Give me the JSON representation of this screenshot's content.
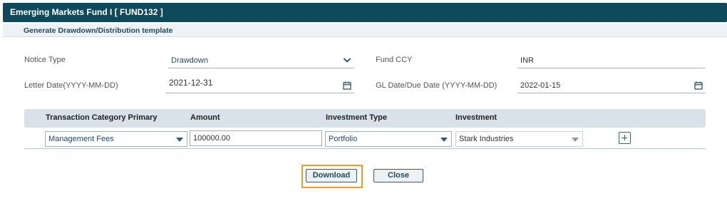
{
  "window": {
    "title": "Emerging Markets Fund I [ FUND132 ]"
  },
  "section": {
    "title": "Generate Drawdown/Distribution template"
  },
  "form": {
    "notice_type": {
      "label": "Notice Type",
      "value": "Drawdown"
    },
    "fund_ccy": {
      "label": "Fund CCY",
      "value": "INR"
    },
    "letter_date": {
      "label": "Letter Date(YYYY-MM-DD)",
      "value": "2021-12-31"
    },
    "gl_date": {
      "label": "GL Date/Due Date (YYYY-MM-DD)",
      "value": "2022-01-15"
    }
  },
  "table": {
    "headers": [
      "Transaction Category Primary",
      "Amount",
      "Investment Type",
      "Investment"
    ],
    "rows": [
      {
        "category": "Management Fees",
        "amount": "100000.00",
        "investment_type": "Portfolio",
        "investment": "Stark Industries"
      }
    ]
  },
  "buttons": {
    "download": "Download",
    "close": "Close"
  },
  "icons": {
    "dropdown": "chevron-down-icon",
    "calendar": "calendar-icon",
    "add": "plus-square-icon"
  },
  "colors": {
    "header_bg": "#0e4a5c",
    "highlight": "#f39a2b"
  }
}
